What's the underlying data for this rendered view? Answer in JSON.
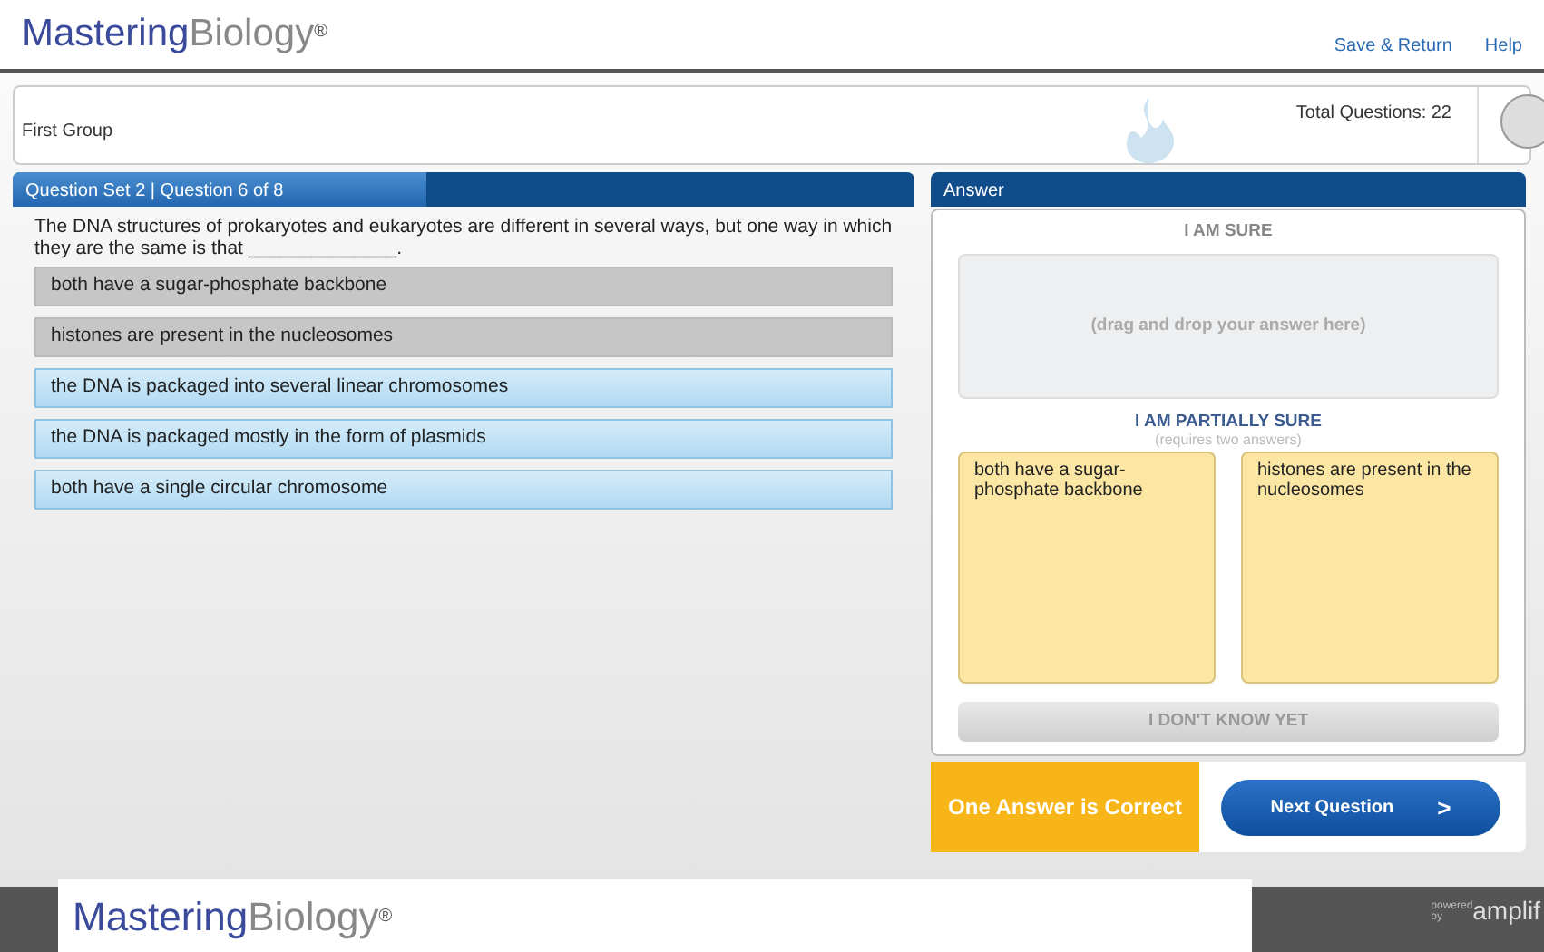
{
  "header": {
    "logo_first": "Mastering",
    "logo_second": "Biology",
    "logo_mark": "®",
    "links": [
      "Save & Return",
      "Help"
    ]
  },
  "info_bar": {
    "group": "First Group",
    "total": "Total Questions: 22"
  },
  "question": {
    "title": "Question Set 2 | Question 6 of 8",
    "prompt": "The DNA structures of prokaryotes and eukaryotes are different in several ways, but one way in which they are the same is that ______________.",
    "options": [
      {
        "text": "both have a sugar-phosphate backbone",
        "placed": true
      },
      {
        "text": "histones are present in the nucleosomes",
        "placed": true
      },
      {
        "text": "the DNA is packaged into several linear chromosomes",
        "placed": false
      },
      {
        "text": "the DNA is packaged mostly in the form of plasmids",
        "placed": false
      },
      {
        "text": "both have a single circular chromosome",
        "placed": false
      }
    ]
  },
  "answer": {
    "title": "Answer",
    "sure_label": "I AM SURE",
    "sure_placeholder": "(drag and drop your answer here)",
    "partial_label": "I AM PARTIALLY SURE",
    "partial_hint": "(requires two answers)",
    "partial_slots": [
      "both have a sugar-phosphate backbone",
      "histones are present in the nucleosomes"
    ],
    "dont_know": "I DON'T KNOW YET",
    "feedback": "One Answer is Correct",
    "next": "Next Question",
    "next_arrow": ">"
  },
  "footer": {
    "powered": "powered by",
    "brand": "amplif"
  },
  "overlay": {
    "logo_first": "Mastering",
    "logo_second": "Biology",
    "logo_mark": "®"
  }
}
